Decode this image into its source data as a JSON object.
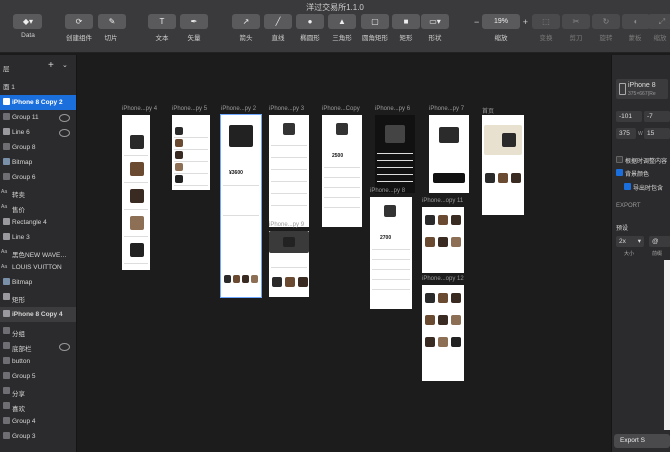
{
  "window": {
    "title": "洋过交易所1.1.0",
    "document_title": "洋过交易所1.1.0"
  },
  "toolbar": {
    "insert": "",
    "data": "Data",
    "create_component": "创建组件",
    "slice": "切片",
    "text": "文本",
    "vector": "矢量",
    "arrow": "箭头",
    "line": "直线",
    "ellipse": "椭圆形",
    "triangle": "三角形",
    "rounded_rect": "圆角矩形",
    "rectangle": "矩形",
    "shape": "形状",
    "zoom_label": "缩放",
    "zoom_value": "19%",
    "transform": "变换",
    "cut": "剪刀",
    "rotate": "旋转",
    "mask": "蒙板",
    "scale": "缩放"
  },
  "layers": {
    "header": "层",
    "page": "面 1",
    "items": [
      {
        "label": "iPhone 8 Copy 2",
        "kind": "artboard-selected"
      },
      {
        "label": "Group 11",
        "kind": "group",
        "hidden": true
      },
      {
        "label": "Line 6",
        "kind": "line",
        "hidden": true
      },
      {
        "label": "Group 8",
        "kind": "group"
      },
      {
        "label": "Bitmap",
        "kind": "bitmap"
      },
      {
        "label": "Group 6",
        "kind": "group"
      },
      {
        "label": "转卖",
        "kind": "text"
      },
      {
        "label": "售价",
        "kind": "text"
      },
      {
        "label": "Rectangle 4",
        "kind": "rect"
      },
      {
        "label": "Line 3",
        "kind": "line"
      },
      {
        "label": "黑色NEW WAVE…",
        "kind": "text"
      },
      {
        "label": "LOUIS VUITTON",
        "kind": "text"
      },
      {
        "label": "Bitmap",
        "kind": "bitmap"
      },
      {
        "label": "矩形",
        "kind": "rect"
      },
      {
        "label": "iPhone 8 Copy 4",
        "kind": "artboard"
      },
      {
        "label": "分组",
        "kind": "group"
      },
      {
        "label": "底部栏",
        "kind": "group",
        "hidden": true
      },
      {
        "label": "button",
        "kind": "group"
      },
      {
        "label": "Group 5",
        "kind": "group"
      },
      {
        "label": "分享",
        "kind": "group"
      },
      {
        "label": "喜欢",
        "kind": "group"
      },
      {
        "label": "Group 4",
        "kind": "group"
      },
      {
        "label": "Group 3",
        "kind": "group"
      }
    ]
  },
  "artboards": [
    {
      "label": "iPhone...py 4"
    },
    {
      "label": "iPhone...py 5"
    },
    {
      "label": "iPhone...py 2"
    },
    {
      "label": "iPhone...py 3"
    },
    {
      "label": "iPhone...Copy"
    },
    {
      "label": "iPhone...py 6"
    },
    {
      "label": "iPhone...py 7"
    },
    {
      "label": "首页"
    },
    {
      "label": "iPhone...py 8"
    },
    {
      "label": "iPhone...py 9"
    },
    {
      "label": "iPhone...opy 11"
    },
    {
      "label": "iPhone...opy 12"
    }
  ],
  "artboard_content": {
    "price_a": "2500",
    "price_b": "2700",
    "price_c": "¥3600"
  },
  "inspector": {
    "device": "iPhone 8",
    "device_size": "375×667(Re",
    "x": "-101",
    "y": "-7",
    "w": "375",
    "w_label": "W",
    "h": "15",
    "adjust_content": "根据时调整内容",
    "background_color": "背景颜色",
    "include_in_export": "导出时包含",
    "export_header": "EXPORT",
    "preset_header": "预设",
    "scale_value": "2x",
    "scale_label": "大小",
    "prefix_value": "@",
    "prefix_label": "前缀",
    "export_button": "Export S"
  }
}
